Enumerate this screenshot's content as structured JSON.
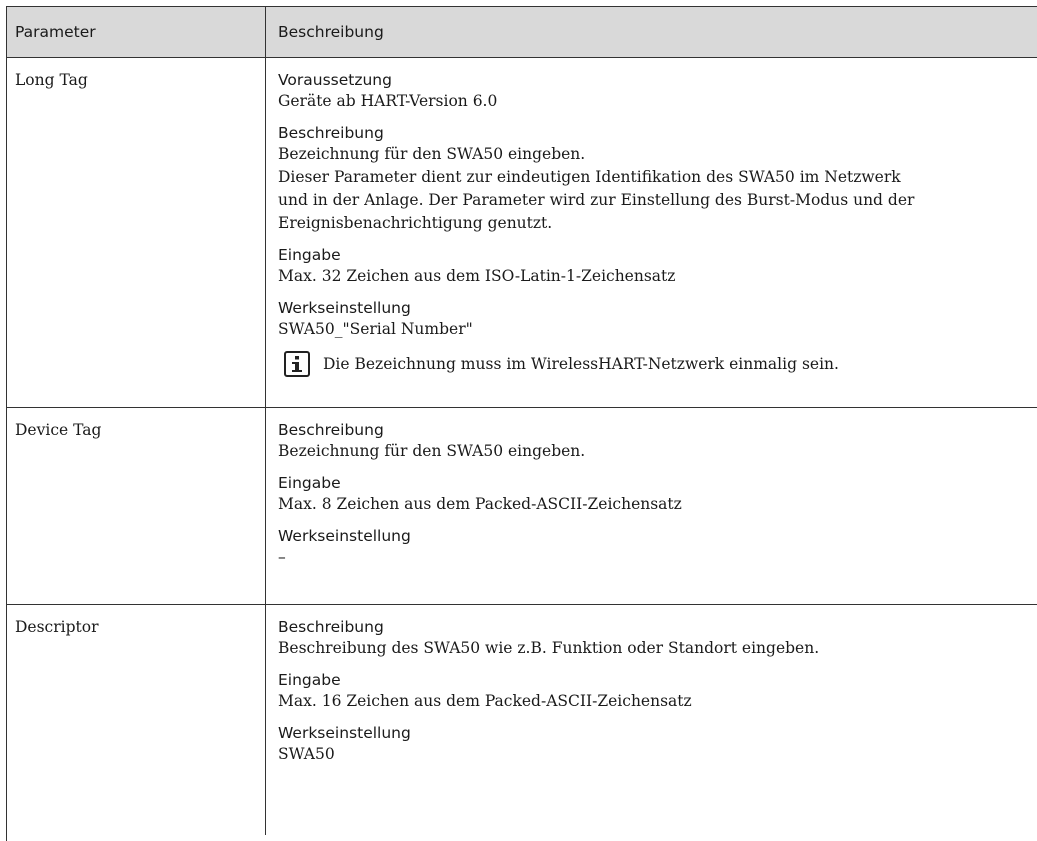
{
  "header": {
    "col_parameter": "Parameter",
    "col_description": "Beschreibung"
  },
  "rows": [
    {
      "parameter": "Long Tag",
      "sections": [
        {
          "label": "Voraussetzung",
          "lines": [
            "Geräte ab HART-Version 6.0"
          ]
        },
        {
          "label": "Beschreibung",
          "lines": [
            "Bezeichnung für den SWA50 eingeben.",
            "Dieser Parameter dient zur eindeutigen Identifikation des SWA50 im Netzwerk",
            "und in der Anlage. Der Parameter wird zur Einstellung des Burst-Modus und der",
            "Ereignisbenachrichtigung genutzt."
          ]
        },
        {
          "label": "Eingabe",
          "lines": [
            "Max. 32 Zeichen aus dem ISO-Latin-1-Zeichensatz"
          ]
        },
        {
          "label": "Werkseinstellung",
          "lines": [
            "SWA50_\"Serial Number\""
          ]
        }
      ],
      "note": "Die Bezeichnung muss im WirelessHART-Netzwerk einmalig sein.",
      "note_icon": "info-icon"
    },
    {
      "parameter": "Device Tag",
      "sections": [
        {
          "label": "Beschreibung",
          "lines": [
            "Bezeichnung für den SWA50 eingeben."
          ]
        },
        {
          "label": "Eingabe",
          "lines": [
            "Max. 8 Zeichen aus dem Packed-ASCII-Zeichensatz"
          ]
        },
        {
          "label": "Werkseinstellung",
          "lines": [
            "–"
          ]
        }
      ]
    },
    {
      "parameter": "Descriptor",
      "sections": [
        {
          "label": "Beschreibung",
          "lines": [
            "Beschreibung des SWA50 wie z.B. Funktion oder Standort eingeben."
          ]
        },
        {
          "label": "Eingabe",
          "lines": [
            "Max. 16 Zeichen aus dem Packed-ASCII-Zeichensatz"
          ]
        },
        {
          "label": "Werkseinstellung",
          "lines": [
            "SWA50"
          ]
        }
      ]
    }
  ],
  "colors": {
    "header_bg": "#d9d9d9",
    "border": "#333333",
    "text": "#1a1a1a"
  }
}
